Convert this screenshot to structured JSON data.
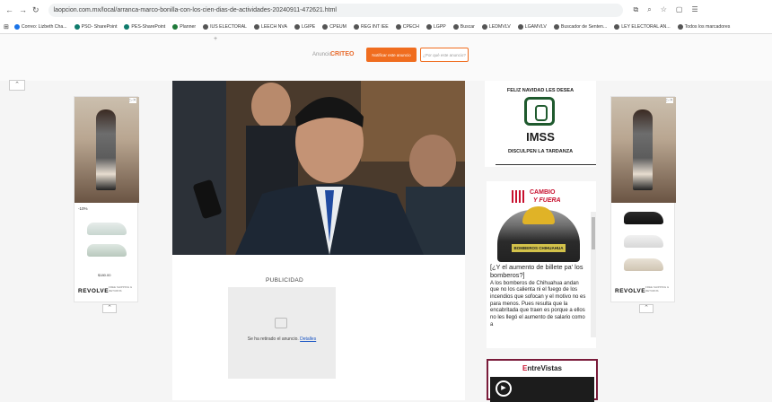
{
  "browser": {
    "url": "laopcion.com.mx/local/arranca-marco-bonilla-con-los-cien-dias-de-actividades-20240911-472621.html",
    "bookmarks": [
      {
        "label": "Correo: Lizbeth Cha...",
        "color": "#1a73e8"
      },
      {
        "label": "PSO- SharePoint",
        "color": "#0f7b6c"
      },
      {
        "label": "PES-SharePoint",
        "color": "#0f7b6c"
      },
      {
        "label": "Planner",
        "color": "#1f7a3a"
      },
      {
        "label": "IUS ELECTORAL",
        "color": "#555555"
      },
      {
        "label": "LEECH NVA",
        "color": "#555555"
      },
      {
        "label": "LGIPE",
        "color": "#555555"
      },
      {
        "label": "CPEUM",
        "color": "#555555"
      },
      {
        "label": "REG INT IEE",
        "color": "#555555"
      },
      {
        "label": "CPECH",
        "color": "#555555"
      },
      {
        "label": "LGPP",
        "color": "#555555"
      },
      {
        "label": "Buscar",
        "color": "#555555"
      },
      {
        "label": "LEDMVLV",
        "color": "#555555"
      },
      {
        "label": "LGAMVLV",
        "color": "#555555"
      },
      {
        "label": "Buscador de Senten...",
        "color": "#555555"
      },
      {
        "label": "LEY ELECTORAL AN...",
        "color": "#555555"
      },
      {
        "label": "Todos los marcadores",
        "color": "#555555"
      }
    ]
  },
  "top_ad": {
    "plus": "+",
    "anuncio": "Anuncio",
    "brand": "CRITEO",
    "btn_primary": "Notificar este anuncio",
    "btn_secondary": "¿Por qué este anuncio?"
  },
  "side_ad": {
    "brand": "REVOLVE",
    "tagline": "FREE SHIPPING & RETURNS",
    "discount": "-10%",
    "price": "$180.00"
  },
  "article": {
    "publicidad": "PUBLICIDAD",
    "ad_removed": "Se ha retirado el anuncio.",
    "details_link": "Detalles"
  },
  "imss_ad": {
    "line1": "FELIZ NAVIDAD LES DESEA",
    "logo": "IMSS",
    "line3": "DISCULPEN LA TARDANZA"
  },
  "cambio_widget": {
    "logo_word1": "CAMBIO",
    "logo_word2": "Y FUERA",
    "shirt_text": "BOMBEROS CHIHUAHUA",
    "headline": "[¿Y el aumento de billete pa' los bomberos?]",
    "body": "A los bomberos de Chihuahua andan que no los calienta ni el fuego de los incendios que sofocan y el motivo no es para menos. Pues resulta que la encabritada que traen es porque a ellos no les llegó el aumento de salario como a"
  },
  "entrevistas": {
    "label_e": "E",
    "label_rest": "ntreVistas"
  }
}
